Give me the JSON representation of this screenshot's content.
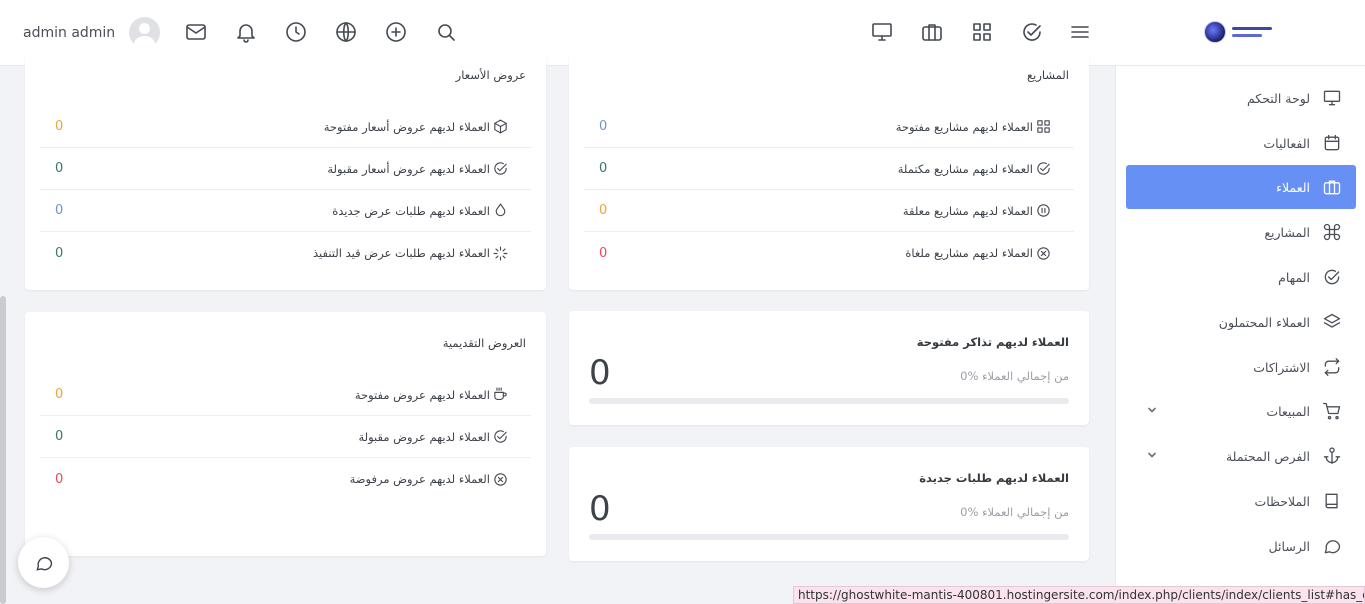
{
  "user": {
    "name": "admin admin"
  },
  "topbar": {
    "icons_left": [
      "mail-icon",
      "bell-icon",
      "clock-icon",
      "globe-icon",
      "plus-circle-icon",
      "search-icon"
    ],
    "icons_right": [
      "monitor-icon",
      "briefcase-icon",
      "grid-icon",
      "check-circle-icon",
      "menu-icon"
    ]
  },
  "sidebar": {
    "items": [
      {
        "label": "لوحة التحكم",
        "icon": "monitor-icon"
      },
      {
        "label": "الفعاليات",
        "icon": "calendar-icon"
      },
      {
        "label": "العملاء",
        "icon": "briefcase-icon",
        "active": true
      },
      {
        "label": "المشاريع",
        "icon": "command-icon"
      },
      {
        "label": "المهام",
        "icon": "check-circle-icon"
      },
      {
        "label": "العملاء المحتملون",
        "icon": "layers-icon"
      },
      {
        "label": "الاشتراكات",
        "icon": "repeat-icon"
      },
      {
        "label": "المبيعات",
        "icon": "cart-icon",
        "has_children": true
      },
      {
        "label": "الفرص المحتملة",
        "icon": "anchor-icon",
        "has_children": true
      },
      {
        "label": "الملاحظات",
        "icon": "book-icon"
      },
      {
        "label": "الرسائل",
        "icon": "message-icon"
      }
    ]
  },
  "projects_card": {
    "title": "المشاريع",
    "rows": [
      {
        "label": "العملاء لديهم مشاريع مفتوحة",
        "value": "0",
        "color": "#6f94c9",
        "icon": "grid-icon"
      },
      {
        "label": "العملاء لديهم مشاريع مكتملة",
        "value": "0",
        "color": "#3b7a5a",
        "icon": "check-circle-icon"
      },
      {
        "label": "العملاء لديهم مشاريع معلقة",
        "value": "0",
        "color": "#f0a437",
        "icon": "pause-circle-icon"
      },
      {
        "label": "العملاء لديهم مشاريع ملغاة",
        "value": "0",
        "color": "#e74c5c",
        "icon": "x-circle-icon"
      }
    ]
  },
  "estimates_card": {
    "title": "عروض الأسعار",
    "rows": [
      {
        "label": "العملاء لديهم عروض أسعار مفتوحة",
        "value": "0",
        "color": "#f0a437",
        "icon": "box-icon"
      },
      {
        "label": "العملاء لديهم عروض أسعار مقبولة",
        "value": "0",
        "color": "#3b7a5a",
        "icon": "check-circle-icon"
      },
      {
        "label": "العملاء لديهم طلبات عرض جديدة",
        "value": "0",
        "color": "#6f94c9",
        "icon": "droplet-icon"
      },
      {
        "label": "العملاء لديهم طلبات عرض قيد التنفيذ",
        "value": "0",
        "color": "#3b7a5a",
        "icon": "loader-icon"
      }
    ]
  },
  "proposals_card": {
    "title": "العروض التقديمية",
    "rows": [
      {
        "label": "العملاء لديهم عروض مفتوحة",
        "value": "0",
        "color": "#f0a437",
        "icon": "coffee-icon"
      },
      {
        "label": "العملاء لديهم عروض مقبولة",
        "value": "0",
        "color": "#3b7a5a",
        "icon": "check-circle-icon"
      },
      {
        "label": "العملاء لديهم عروض مرفوضة",
        "value": "0",
        "color": "#e74c5c",
        "icon": "x-circle-icon"
      }
    ]
  },
  "tickets_card": {
    "title": "العملاء لديهم تذاكر مفتوحة",
    "value": "0",
    "sub": "0% من إجمالي العملاء",
    "progress": 0
  },
  "orders_card": {
    "title": "العملاء لديهم طلبات جديدة",
    "value": "0",
    "sub": "0% من إجمالي العملاء",
    "progress": 0
  },
  "statusbar": {
    "url": "https://ghostwhite-mantis-400801.hostingersite.com/index.php/clients/index/clients_list#has_open_tickets"
  }
}
